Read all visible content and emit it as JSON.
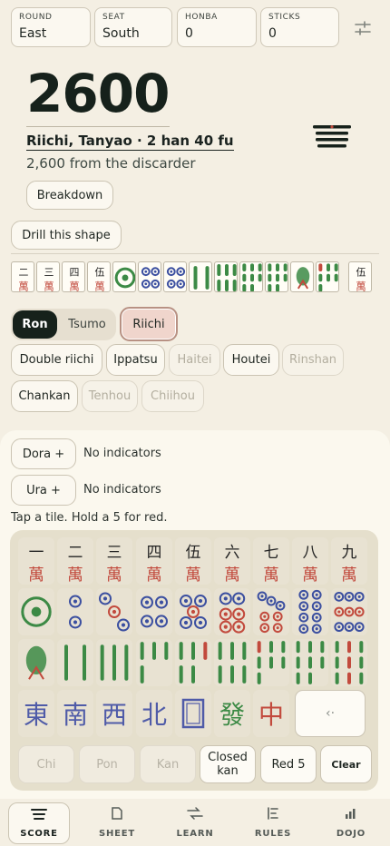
{
  "header": {
    "fields": [
      {
        "label": "ROUND",
        "value": "East"
      },
      {
        "label": "SEAT",
        "value": "South"
      },
      {
        "label": "HONBA",
        "value": "0"
      },
      {
        "label": "STICKS",
        "value": "0"
      }
    ],
    "settings_icon": "sliders-icon"
  },
  "result": {
    "points": "2600",
    "yaku_line": "Riichi, Tanyao · 2 han 40 fu",
    "payment_line": "2,600 from the discarder",
    "breakdown_label": "Breakdown",
    "drill_label": "Drill this shape"
  },
  "hand": {
    "tiles": [
      "2-man",
      "3-man",
      "4-man",
      "5-man",
      "1-pin",
      "4-pin",
      "4-pin",
      "2-sou",
      "6-sou",
      "8-sou",
      "8-sou",
      "1-sou",
      "7-sou",
      "5-man"
    ]
  },
  "win_type": {
    "ron": "Ron",
    "tsumo": "Tsumo",
    "selected": "Ron"
  },
  "riichi_label": "Riichi",
  "options": [
    {
      "label": "Double riichi",
      "enabled": true
    },
    {
      "label": "Ippatsu",
      "enabled": true
    },
    {
      "label": "Haitei",
      "enabled": false
    },
    {
      "label": "Houtei",
      "enabled": true
    },
    {
      "label": "Rinshan",
      "enabled": false
    },
    {
      "label": "Chankan",
      "enabled": true
    },
    {
      "label": "Tenhou",
      "enabled": false
    },
    {
      "label": "Chiihou",
      "enabled": false
    }
  ],
  "dora": {
    "button": "Dora +",
    "text": "No indicators"
  },
  "ura": {
    "button": "Ura +",
    "text": "No indicators"
  },
  "hint": "Tap a tile. Hold a 5 for red.",
  "keyboard": {
    "man": [
      "一",
      "二",
      "三",
      "四",
      "伍",
      "六",
      "七",
      "八",
      "九"
    ],
    "man_suit": "萬",
    "honors": [
      "東",
      "南",
      "西",
      "北",
      "白",
      "發",
      "中"
    ],
    "backspace_icon": "backspace-icon",
    "actions": [
      {
        "label": "Chi",
        "enabled": false
      },
      {
        "label": "Pon",
        "enabled": false
      },
      {
        "label": "Kan",
        "enabled": false
      },
      {
        "label": "Closed kan",
        "enabled": true
      },
      {
        "label": "Red 5",
        "enabled": true
      },
      {
        "label": "Clear",
        "enabled": true
      }
    ]
  },
  "colors": {
    "accent_dark": "#16211b",
    "riichi_fill": "#f0d5cc",
    "man_red": "#c24a3d",
    "sou_green": "#3c8a45",
    "pin_blue": "#3b4fa0"
  },
  "nav": [
    {
      "label": "SCORE",
      "icon": "score-icon",
      "active": true
    },
    {
      "label": "SHEET",
      "icon": "sheet-icon",
      "active": false
    },
    {
      "label": "LEARN",
      "icon": "learn-icon",
      "active": false
    },
    {
      "label": "RULES",
      "icon": "rules-icon",
      "active": false
    },
    {
      "label": "DOJO",
      "icon": "dojo-icon",
      "active": false
    }
  ]
}
